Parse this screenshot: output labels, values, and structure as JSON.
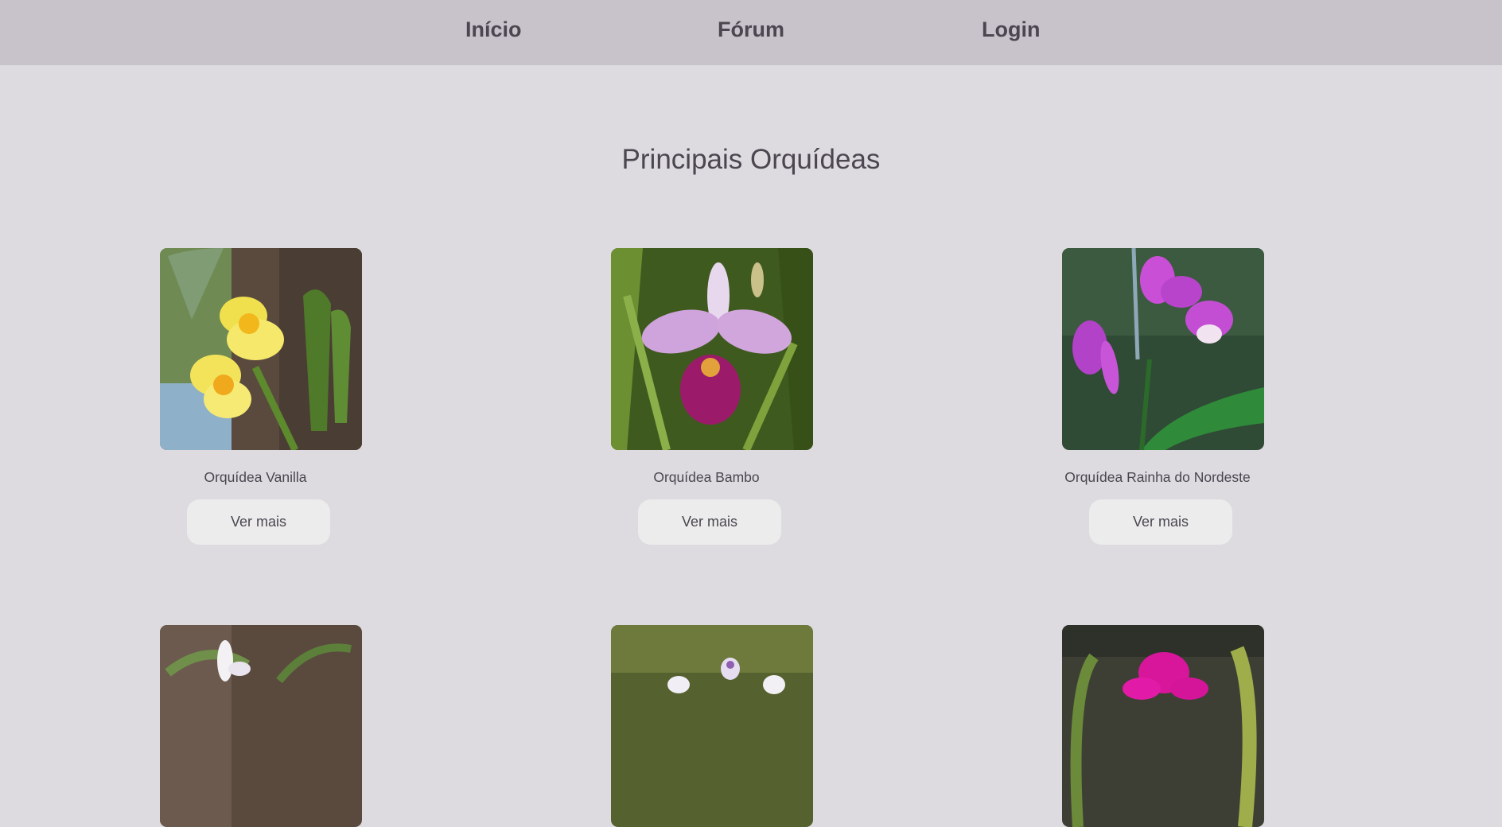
{
  "nav": {
    "items": [
      {
        "label": "Início"
      },
      {
        "label": "Fórum"
      },
      {
        "label": "Login"
      }
    ]
  },
  "main": {
    "title": "Principais Orquídeas",
    "cards": [
      {
        "name": "Orquídea Vanilla",
        "button": "Ver mais"
      },
      {
        "name": "Orquídea Bambo",
        "button": "Ver mais"
      },
      {
        "name": "Orquídea Rainha do Nordeste",
        "button": "Ver mais"
      }
    ]
  },
  "colors": {
    "background": "#dddbdf",
    "navbar": "#c8c3ca",
    "text": "#4b4650",
    "button": "#ececec"
  }
}
